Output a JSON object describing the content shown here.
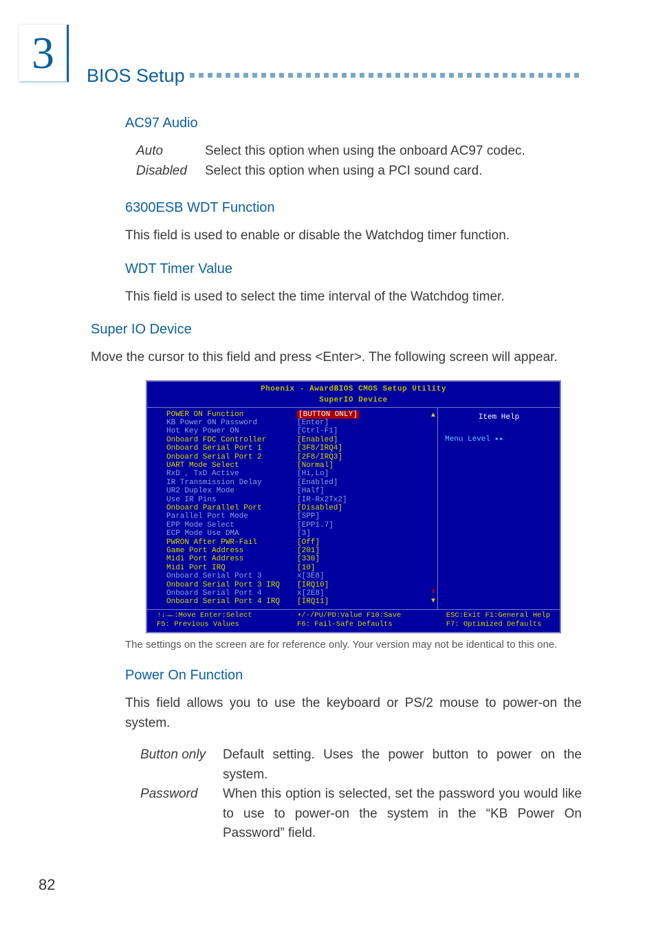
{
  "chapter": "3",
  "page_title": "BIOS Setup",
  "page_number": "82",
  "sections": {
    "ac97": {
      "heading": "AC97 Audio",
      "opts": [
        {
          "label": "Auto",
          "desc": "Select this option when using the onboard AC97 codec."
        },
        {
          "label": "Disabled",
          "desc": "Select this option when using a PCI sound card."
        }
      ]
    },
    "wdt_func": {
      "heading": "6300ESB WDT Function",
      "para": "This field is used to enable or disable the Watchdog timer function."
    },
    "wdt_val": {
      "heading": "WDT Timer Value",
      "para": "This field is used to select the time interval of the Watchdog timer."
    },
    "superio": {
      "heading": "Super IO Device",
      "para": "Move the cursor to this field and press <Enter>. The following screen will appear."
    },
    "caption": "The settings on the screen are for reference only. Your version may not be identical to this one.",
    "poweron": {
      "heading": "Power On Function",
      "para": "This field allows you to use the keyboard or PS/2 mouse to power-on the system.",
      "opts": [
        {
          "label": "Button only",
          "desc": "Default setting. Uses the power button to power on the system."
        },
        {
          "label": "Password",
          "desc": "When this option is selected, set the password you would like to use to power-on the system in the “KB Power On Password” field."
        }
      ]
    }
  },
  "bios": {
    "title_a": "Phoenix - AwardBIOS CMOS Setup Utility",
    "title_b": "SuperIO Device",
    "help_title": "Item Help",
    "help_level": "Menu Level   ▸▸",
    "rows": [
      {
        "k": "POWER ON Function",
        "v": "[BUTTON ONLY]",
        "sel": true
      },
      {
        "k": "KB Power ON Password",
        "v": "[Enter]",
        "gray": true
      },
      {
        "k": "Hot Key Power ON",
        "v": "[Ctrl-F1]",
        "gray": true
      },
      {
        "k": "Onboard FDC Controller",
        "v": "[Enabled]"
      },
      {
        "k": "Onboard Serial Port 1",
        "v": "[3F8/IRQ4]"
      },
      {
        "k": "Onboard Serial Port 2",
        "v": "[2F8/IRQ3]"
      },
      {
        "k": "UART Mode Select",
        "v": "[Normal]"
      },
      {
        "k": "RxD , TxD Active",
        "v": "[Hi,Lo]",
        "gray": true
      },
      {
        "k": "IR Transmission Delay",
        "v": "[Enabled]",
        "gray": true
      },
      {
        "k": "UR2 Duplex Mode",
        "v": "[Half]",
        "gray": true
      },
      {
        "k": "Use IR Pins",
        "v": "[IR-Rx2Tx2]",
        "gray": true
      },
      {
        "k": "Onboard Parallel Port",
        "v": "[Disabled]"
      },
      {
        "k": "Parallel Port Mode",
        "v": "[SPP]",
        "gray": true
      },
      {
        "k": "EPP Mode Select",
        "v": "[EPP1.7]",
        "gray": true
      },
      {
        "k": "ECP Mode Use DMA",
        "v": "[3]",
        "gray": true
      },
      {
        "k": "PWRON After PWR-Fail",
        "v": "[Off]"
      },
      {
        "k": "Game Port Address",
        "v": "[201]"
      },
      {
        "k": "Midi Port Address",
        "v": "[330]"
      },
      {
        "k": "Midi Port IRQ",
        "v": "[10]"
      },
      {
        "k": "Onboard Serial Port 3",
        "v": "x[3E8]",
        "gray": true
      },
      {
        "k": "Onboard Serial Port 3 IRQ",
        "v": "[IRQ10]"
      },
      {
        "k": "Onboard Serial Port 4",
        "v": "x[2E8]",
        "gray": true
      },
      {
        "k": "Onboard Serial Port 4 IRQ",
        "v": "[IRQ11]"
      }
    ],
    "foot_l1a": "↑↓→←:Move  Enter:Select",
    "foot_l1b": "+/-/PU/PD:Value  F10:Save",
    "foot_l1c": "ESC:Exit  F1:General Help",
    "foot_l2a": "F5: Previous Values",
    "foot_l2b": "F6: Fail-Safe Defaults",
    "foot_l2c": "F7: Optimized Defaults"
  }
}
